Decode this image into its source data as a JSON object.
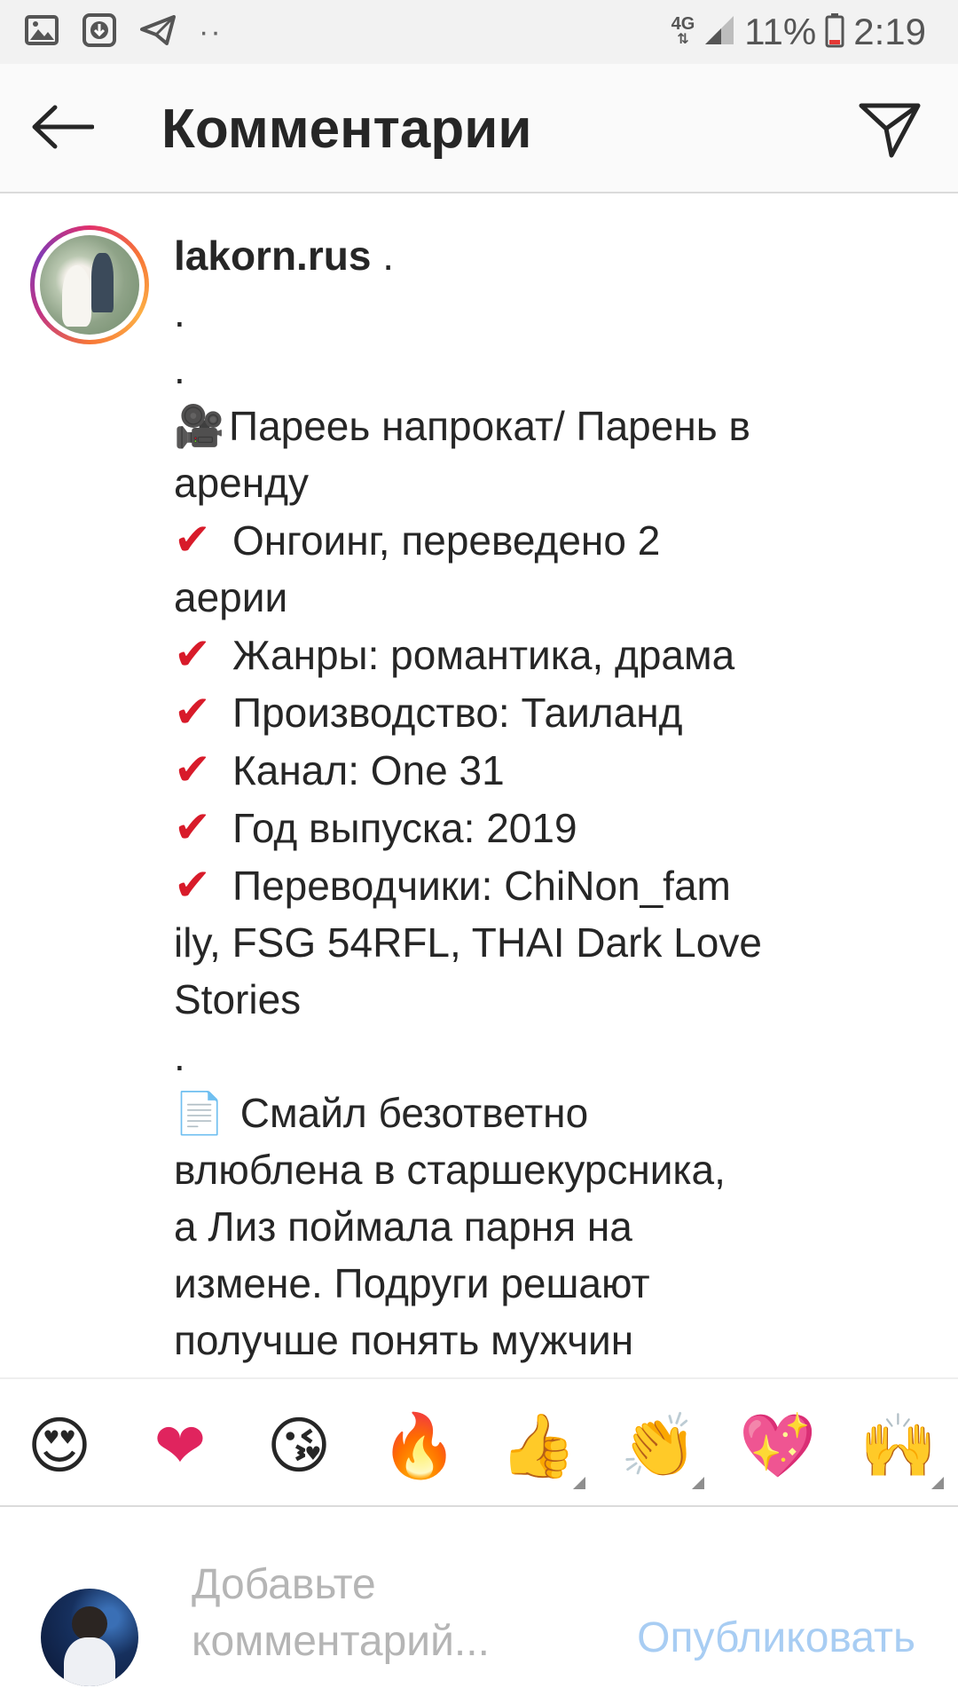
{
  "status_bar": {
    "icons": [
      "gallery-icon",
      "download-icon",
      "telegram-icon"
    ],
    "more": "··",
    "network": "4G",
    "battery_percent": "11%",
    "time": "2:19"
  },
  "header": {
    "back_icon": "arrow-left-icon",
    "title": "Комментарии",
    "send_icon": "paper-plane-icon"
  },
  "comment": {
    "username": "lakorn.rus",
    "lines": [
      {
        "prefix": "",
        "text": " ."
      },
      {
        "prefix": "",
        "text": "."
      },
      {
        "prefix": "",
        "text": "."
      },
      {
        "prefix": "🎥",
        "text": "Пареeь напрокат/ Парень в"
      },
      {
        "prefix": "",
        "text": "аренду"
      },
      {
        "prefix": "✔",
        "text": "Онгоинг, переведено 2"
      },
      {
        "prefix": "",
        "text": "аерии"
      },
      {
        "prefix": "✔",
        "text": "Жанры: романтика, драма"
      },
      {
        "prefix": "✔",
        "text": "Производство: Таиланд"
      },
      {
        "prefix": "✔",
        "text": "Канал: One 31"
      },
      {
        "prefix": "✔",
        "text": "Год выпуска: 2019"
      },
      {
        "prefix": "✔",
        "text": "Переводчики: ChiNon_fam"
      },
      {
        "prefix": "",
        "text": "ily, FSG 54RFL, THAI Dark Love"
      },
      {
        "prefix": "",
        "text": "Stories"
      },
      {
        "prefix": "",
        "text": "."
      },
      {
        "prefix": "📄",
        "text": " Смайл безответно"
      },
      {
        "prefix": "",
        "text": "влюблена в старшекурсника,"
      },
      {
        "prefix": "",
        "text": "а Лиз поймала парня на"
      },
      {
        "prefix": "",
        "text": "измене. Подруги решают"
      },
      {
        "prefix": "",
        "text": "получше понять мужчин"
      }
    ]
  },
  "emoji_bar": {
    "emojis": [
      "😍",
      "❤",
      "😘",
      "🔥",
      "👍",
      "👏",
      "💖",
      "🙌"
    ]
  },
  "compose": {
    "placeholder_line1": "Добавьте",
    "placeholder_line2": "комментарий...",
    "publish_label": "Опубликовать"
  }
}
